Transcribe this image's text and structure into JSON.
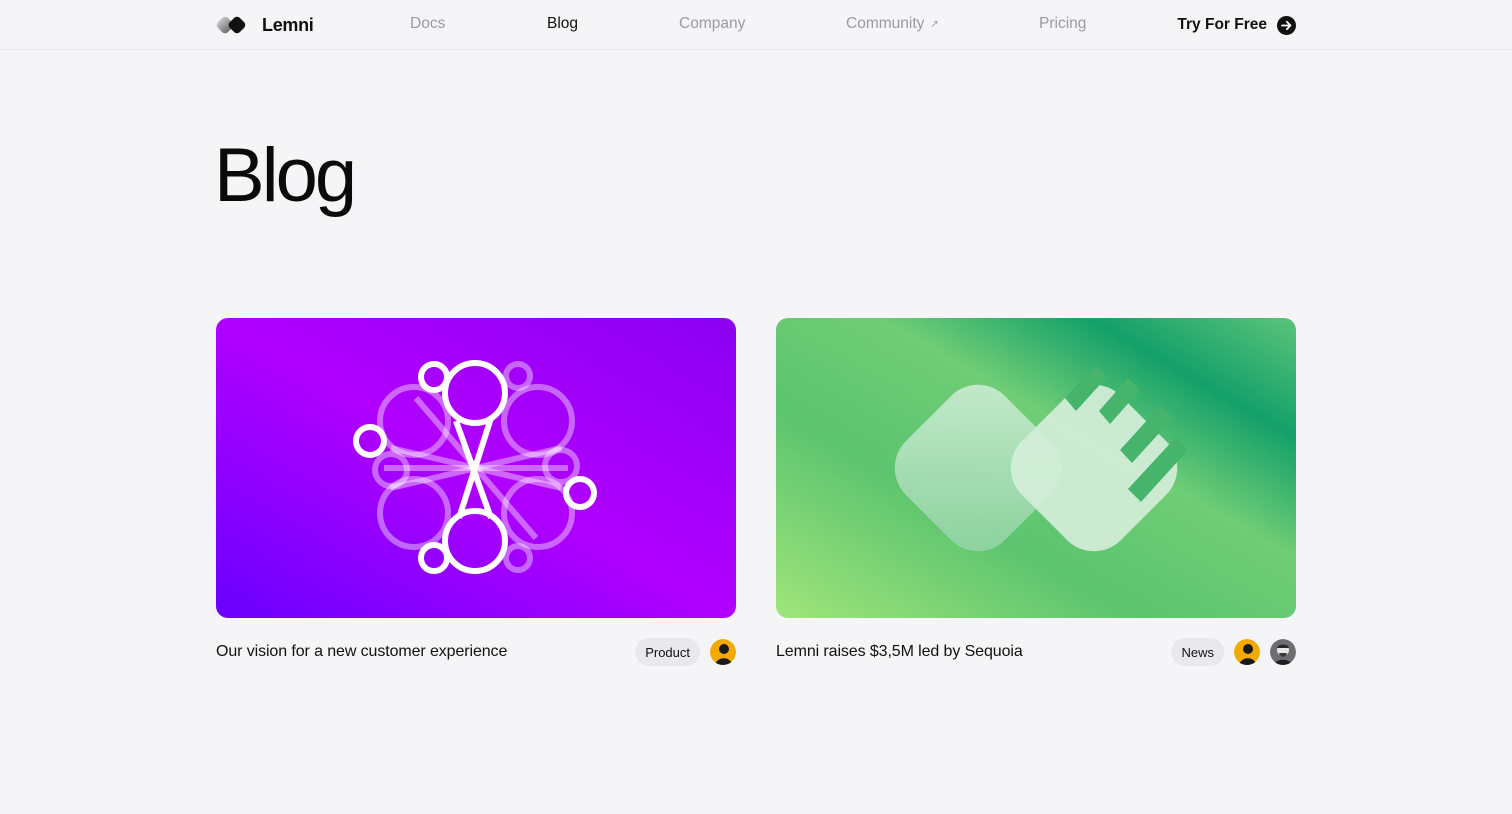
{
  "nav": {
    "brand": "Lemni",
    "links": [
      {
        "label": "Docs",
        "active": false
      },
      {
        "label": "Blog",
        "active": true
      },
      {
        "label": "Company",
        "active": false
      },
      {
        "label": "Community",
        "active": false,
        "external_icon": "external-arrow-icon",
        "external_glyph": "↗"
      },
      {
        "label": "Pricing",
        "active": false
      }
    ],
    "cta": {
      "label": "Try For Free",
      "icon": "arrow-right-circle-icon"
    }
  },
  "page": {
    "title": "Blog"
  },
  "posts": [
    {
      "title": "Our vision for a new customer experience",
      "tag": "Product",
      "image_icon": "network-graph-illustration",
      "gradient": [
        "#7a00ff",
        "#c000ff"
      ],
      "authors": [
        "author-avatar"
      ]
    },
    {
      "title": "Lemni raises $3,5M led by Sequoia",
      "tag": "News",
      "image_icon": "lemni-logo-illustration",
      "gradient": [
        "#9be27a",
        "#16a36b"
      ],
      "authors": [
        "author-avatar",
        "author-avatar"
      ]
    }
  ],
  "colors": {
    "background": "#f5f5f7",
    "muted_nav": "#9a9aa0",
    "tag_bg": "#e9e9ed"
  }
}
